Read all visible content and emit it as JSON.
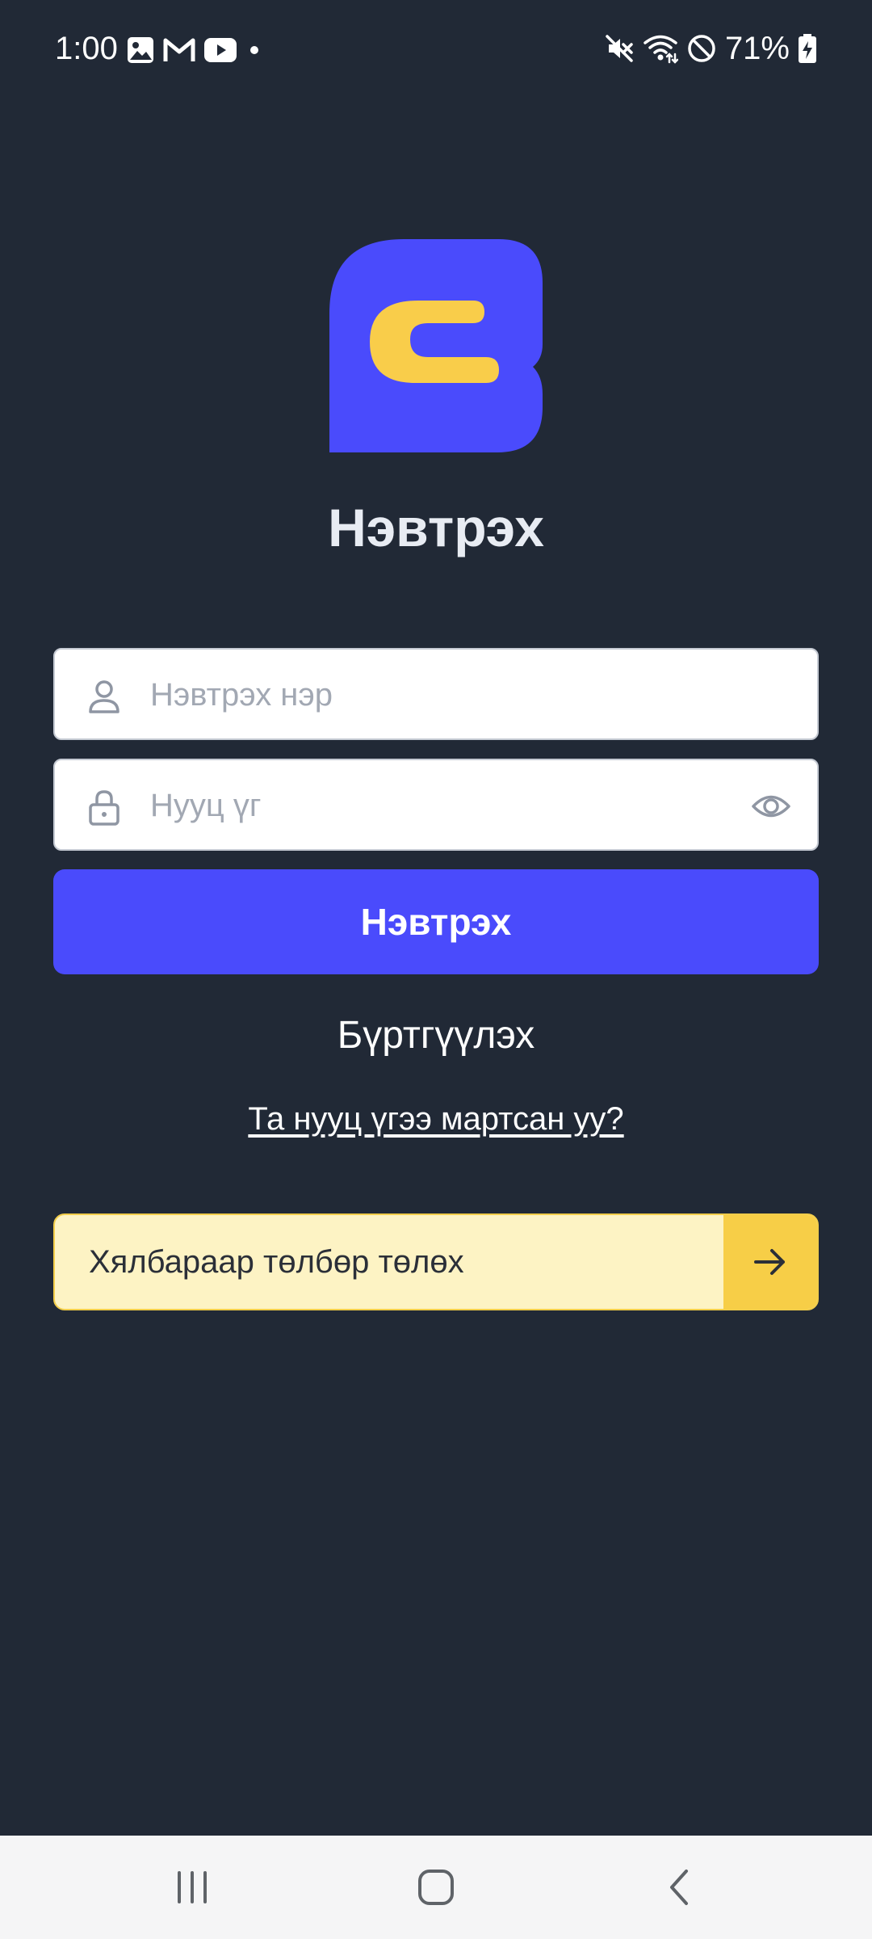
{
  "status_bar": {
    "time": "1:00",
    "battery_percent": "71%",
    "left_icons": [
      "image-icon",
      "gmail-icon",
      "youtube-icon",
      "dot-icon"
    ],
    "right_icons": [
      "mute-icon",
      "wifi-icon",
      "do-not-disturb-icon",
      "battery-charging-icon"
    ]
  },
  "login": {
    "title": "Нэвтрэх",
    "username_placeholder": "Нэвтрэх нэр",
    "password_placeholder": "Нууц үг",
    "submit_label": "Нэвтрэх",
    "register_label": "Бүртгүүлэх",
    "forgot_label": "Та нууц үгээ мартсан уу?"
  },
  "pay_banner": {
    "label": "Хялбараар төлбөр төлөх",
    "icon": "arrow-right-icon"
  },
  "colors": {
    "background": "#212936",
    "primary": "#4a4bfc",
    "accent": "#f7ce47",
    "banner_bg": "#fdf3c4"
  },
  "nav_bar": {
    "buttons": [
      "recent-apps-icon",
      "home-icon",
      "back-icon"
    ]
  }
}
